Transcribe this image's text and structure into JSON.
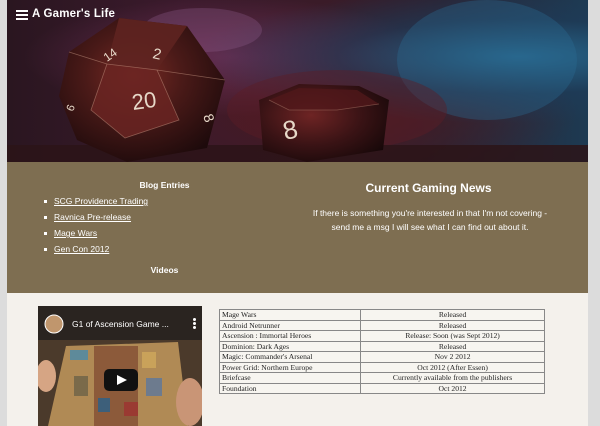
{
  "header": {
    "site_title": "A Gamer's Life"
  },
  "sidebar": {
    "blog_heading": "Blog Entries",
    "blog_links": [
      "SCG Providence Trading",
      "Ravnica Pre-release",
      "Mage Wars",
      "Gen Con 2012"
    ],
    "videos_heading": "Videos"
  },
  "news": {
    "heading": "Current Gaming News",
    "text": "If there is something you're interested in that I'm not covering - send me a msg I will see what I can find out about it."
  },
  "video": {
    "title": "G1 of Ascension Game ..."
  },
  "releases": [
    {
      "game": "Mage Wars",
      "status": "Released"
    },
    {
      "game": "Android Netrunner",
      "status": "Released"
    },
    {
      "game": "Ascension : Immortal Heroes",
      "status": "Release: Soon (was Sept 2012)"
    },
    {
      "game": "Dominion: Dark Ages",
      "status": "Released"
    },
    {
      "game": "Magic: Commander's Arsenal",
      "status": "Nov 2 2012"
    },
    {
      "game": "Power Grid: Northern Europe",
      "status": "Oct 2012 (After Essen)"
    },
    {
      "game": "Briefcase",
      "status": "Currently available from the publishers"
    },
    {
      "game": "Foundation",
      "status": "Oct 2012"
    }
  ],
  "hero_dice": {
    "die1_numbers": [
      "20",
      "2",
      "8",
      "14",
      "6"
    ],
    "die2_number": "8"
  },
  "colors": {
    "band": "#7e6e51",
    "page_bg": "#f4f1ec"
  },
  "icons": {
    "menu": "hamburger-menu-icon",
    "play": "play-icon"
  }
}
